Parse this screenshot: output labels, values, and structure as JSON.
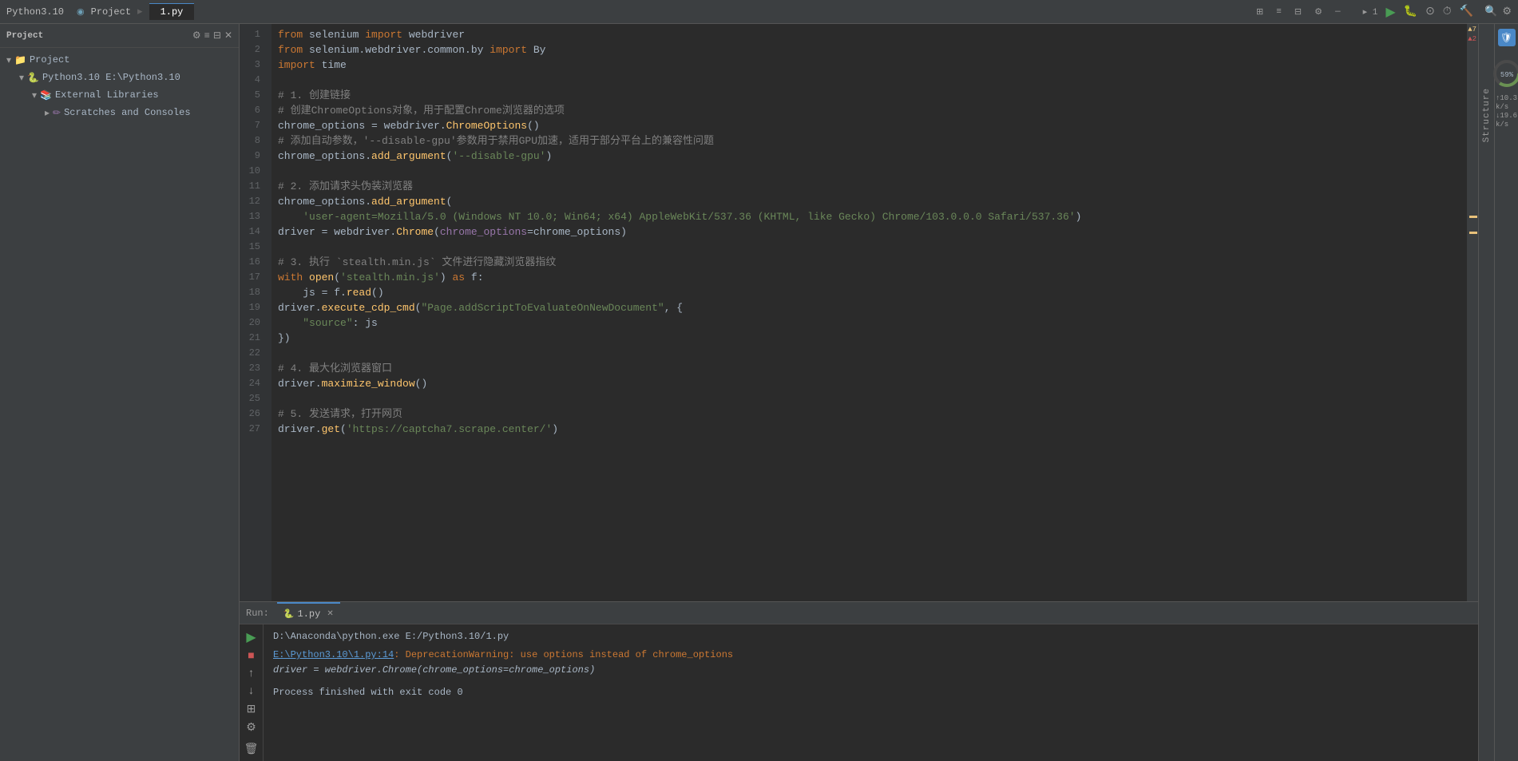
{
  "titlebar": {
    "app_title": "Python3.10",
    "file_tab": "1.py",
    "toolbar_icons": [
      "grid-icon",
      "list-icon",
      "split-icon",
      "settings-icon",
      "close-icon"
    ]
  },
  "sidebar": {
    "header_label": "Project",
    "tree": [
      {
        "label": "Project",
        "type": "folder",
        "indent": 0,
        "expanded": true
      },
      {
        "label": "Python3.10  E:\\Python3.10",
        "type": "folder-python",
        "indent": 1,
        "expanded": true
      },
      {
        "label": "External Libraries",
        "type": "library",
        "indent": 2,
        "expanded": true
      },
      {
        "label": "Scratches and Consoles",
        "type": "scratches",
        "indent": 3,
        "expanded": false
      }
    ]
  },
  "editor": {
    "filename": "1.py",
    "lines": [
      {
        "num": 1,
        "content": "from selenium import webdriver"
      },
      {
        "num": 2,
        "content": "from selenium.webdriver.common.by import By"
      },
      {
        "num": 3,
        "content": "import time"
      },
      {
        "num": 4,
        "content": ""
      },
      {
        "num": 5,
        "content": "# 1. 创建链接"
      },
      {
        "num": 6,
        "content": "# 创建ChromeOptions对象，用于配置Chrome浏览器的选项"
      },
      {
        "num": 7,
        "content": "chrome_options = webdriver.ChromeOptions()"
      },
      {
        "num": 8,
        "content": "# 添加自动参数，'--disable-gpu'参数用于禁用GPU加速，适用于部分平台上的兼容性问题"
      },
      {
        "num": 9,
        "content": "chrome_options.add_argument('--disable-gpu')"
      },
      {
        "num": 10,
        "content": ""
      },
      {
        "num": 11,
        "content": "# 2. 添加请求头伪装浏览器"
      },
      {
        "num": 12,
        "content": "chrome_options.add_argument("
      },
      {
        "num": 13,
        "content": "    'user-agent=Mozilla/5.0 (Windows NT 10.0; Win64; x64) AppleWebKit/537.36 (KHTML, like Gecko) Chrome/103.0.0.0 Safari/537.36')"
      },
      {
        "num": 14,
        "content": "driver = webdriver.Chrome(chrome_options=chrome_options)"
      },
      {
        "num": 15,
        "content": ""
      },
      {
        "num": 16,
        "content": "# 3. 执行 `stealth.min.js` 文件进行隐藏浏览器指纹"
      },
      {
        "num": 17,
        "content": "with open('stealth.min.js') as f:"
      },
      {
        "num": 18,
        "content": "    js = f.read()"
      },
      {
        "num": 19,
        "content": "driver.execute_cdp_cmd(\"Page.addScriptToEvaluateOnNewDocument\", {"
      },
      {
        "num": 20,
        "content": "    \"source\": js"
      },
      {
        "num": 21,
        "content": "})"
      },
      {
        "num": 22,
        "content": ""
      },
      {
        "num": 23,
        "content": "# 4. 最大化浏览器窗口"
      },
      {
        "num": 24,
        "content": "driver.maximize_window()"
      },
      {
        "num": 25,
        "content": ""
      },
      {
        "num": 26,
        "content": "# 5. 发送请求，打开网页"
      },
      {
        "num": 27,
        "content": "driver.get('https://captcha7.scrape.center/')"
      }
    ]
  },
  "run_panel": {
    "tab_label": "1.py",
    "tab_num": "1",
    "command": "D:\\Anaconda\\python.exe E:/Python3.10/1.py",
    "warning_text": "E:\\Python3.10\\1.py:14: DeprecationWarning: use options instead of chrome_options",
    "warning_file_link": "E:\\Python3.10\\1.py:14",
    "warning_detail": "DeprecationWarning: use options instead of chrome_options",
    "code_line": "  driver = webdriver.Chrome(chrome_options=chrome_options)",
    "exit_text": "Process finished with exit code 0"
  },
  "right_gutter": {
    "warning_count": "▲7",
    "error_count": "▲2"
  },
  "status_bar": {
    "items": []
  },
  "network": {
    "upload": "10.3",
    "upload_unit": "k/s",
    "download": "19.6",
    "download_unit": "k/s"
  },
  "memory": {
    "percent": "59%"
  },
  "structure_label": "Structure",
  "indicators": {
    "run_num": "1",
    "warn_label": "▲7",
    "err_label": "▲2"
  }
}
